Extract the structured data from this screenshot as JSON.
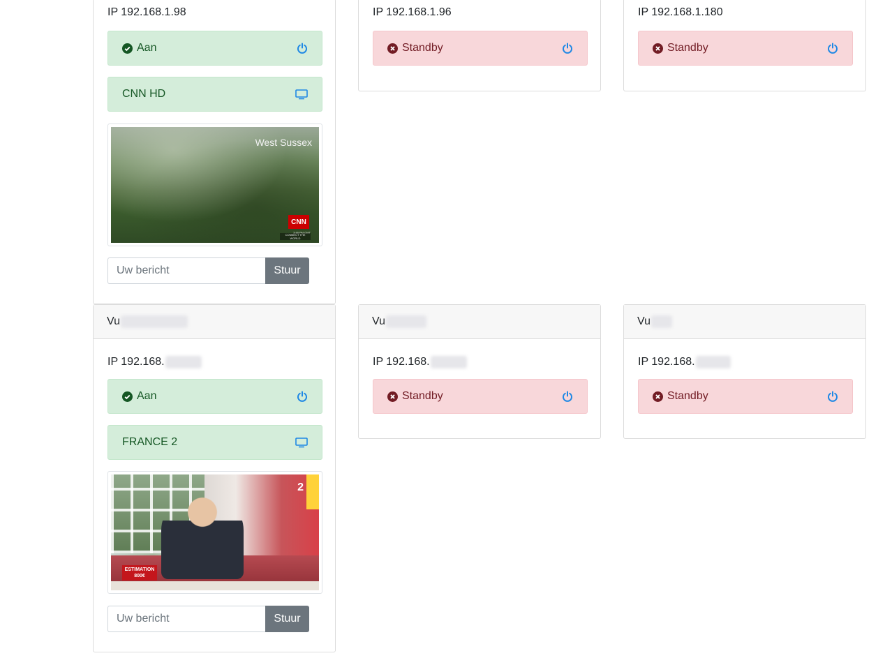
{
  "devices_top": [
    {
      "ip": "IP 192.168.1.98",
      "power_status": "Aan",
      "channel": "CNN HD",
      "thumb_overlay": "West Sussex",
      "thumb_logo": "CNN",
      "thumb_time": "3:48 PM GMT",
      "thumb_tag": "CONNECT THE WORLD",
      "message_placeholder": "Uw bericht",
      "send_label": "Stuur"
    },
    {
      "ip": "IP 192.168.1.96",
      "power_status": "Standby"
    },
    {
      "ip": "IP 192.168.1.180",
      "power_status": "Standby"
    }
  ],
  "devices_bottom": [
    {
      "name": "Vu",
      "ip": "IP 192.168.",
      "power_status": "Aan",
      "channel": "FRANCE 2",
      "thumb_overlay": "ESTIMATION 800€",
      "thumb_logo": "2",
      "message_placeholder": "Uw bericht",
      "send_label": "Stuur"
    },
    {
      "name": "Vu",
      "ip": "IP 192.168.",
      "power_status": "Standby"
    },
    {
      "name": "Vu",
      "ip": "IP 192.168.",
      "power_status": "Standby"
    }
  ],
  "colors": {
    "success_bg": "#d4edda",
    "success_text": "#155724",
    "danger_bg": "#f8d7da",
    "danger_text": "#721c24",
    "power_icon": "#1e88e5",
    "button_bg": "#6c757d"
  },
  "icons": {
    "power": "power-icon",
    "on": "check-circle-icon",
    "off": "times-circle-icon",
    "channel": "monitor-icon"
  }
}
